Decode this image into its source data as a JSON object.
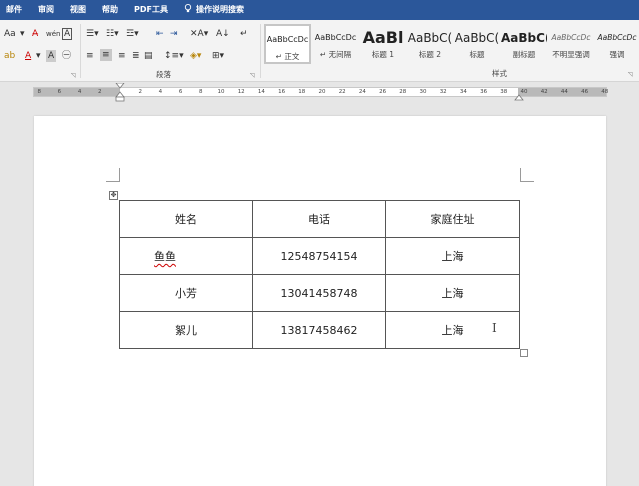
{
  "tabs": [
    "邮件",
    "审阅",
    "视图",
    "帮助",
    "PDF工具",
    "操作说明搜索"
  ],
  "ribbon": {
    "font_size_btn": "Aa",
    "paragraph_label": "段落",
    "styles_label": "样式"
  },
  "styles_gallery": [
    {
      "sample": "AaBbCcDc",
      "name": "↵ 正文"
    },
    {
      "sample": "AaBbCcDc",
      "name": "↵ 无间隔"
    },
    {
      "sample": "AaBl",
      "name": "标题 1"
    },
    {
      "sample": "AaBbC(",
      "name": "标题 2"
    },
    {
      "sample": "AaBbC(",
      "name": "标题"
    },
    {
      "sample": "AaBbC(",
      "name": "副标题"
    },
    {
      "sample": "AaBbCcDc",
      "name": "不明显强调"
    },
    {
      "sample": "AaBbCcDc",
      "name": "强调"
    }
  ],
  "ruler_ticks": [
    "8",
    "6",
    "4",
    "2",
    "2",
    "4",
    "6",
    "8",
    "10",
    "12",
    "14",
    "16",
    "18",
    "20",
    "22",
    "24",
    "26",
    "28",
    "30",
    "32",
    "34",
    "36",
    "38",
    "40",
    "42",
    "44",
    "46",
    "48"
  ],
  "table": {
    "header": [
      "姓名",
      "电话",
      "家庭住址"
    ],
    "rows": [
      [
        "鱼鱼",
        "12548754154",
        "上海"
      ],
      [
        "小芳",
        "13041458748",
        "上海"
      ],
      [
        "絮儿",
        "13817458462",
        "上海"
      ]
    ]
  },
  "colors": {
    "tab_bar": "#2b579a",
    "ribbon_bg": "#f3f3f3",
    "canvas_bg": "#e6e6e6",
    "table_border": "#555555"
  }
}
